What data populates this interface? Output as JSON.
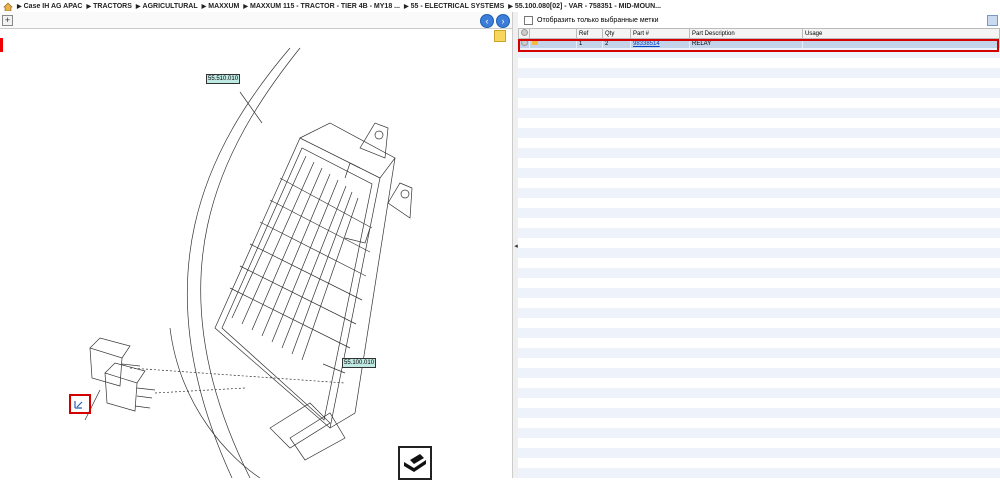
{
  "breadcrumb": [
    "Case IH AG APAC",
    "TRACTORS",
    "AGRICULTURAL",
    "MAXXUM",
    "MAXXUM 115 - TRACTOR - TIER 4B - MY18 ...",
    "55 - ELECTRICAL SYSTEMS",
    "55.100.080[02] - VAR - 758351 - MID-MOUN..."
  ],
  "drawing": {
    "callouts": [
      "55.510.010",
      "55.100.010"
    ]
  },
  "parts_panel": {
    "filter_label": "Отобразить только выбранные метки",
    "columns": [
      "",
      "",
      "Ref",
      "Qty",
      "Part #",
      "Part Description",
      "Usage"
    ],
    "rows": [
      {
        "ref": "1",
        "qty": "2",
        "part": "98338514",
        "desc": "RELAY",
        "usage": ""
      }
    ]
  },
  "colors": {
    "accent": "#3b7dd8",
    "selection": "#d40000",
    "callout": "#bfe9e3"
  }
}
